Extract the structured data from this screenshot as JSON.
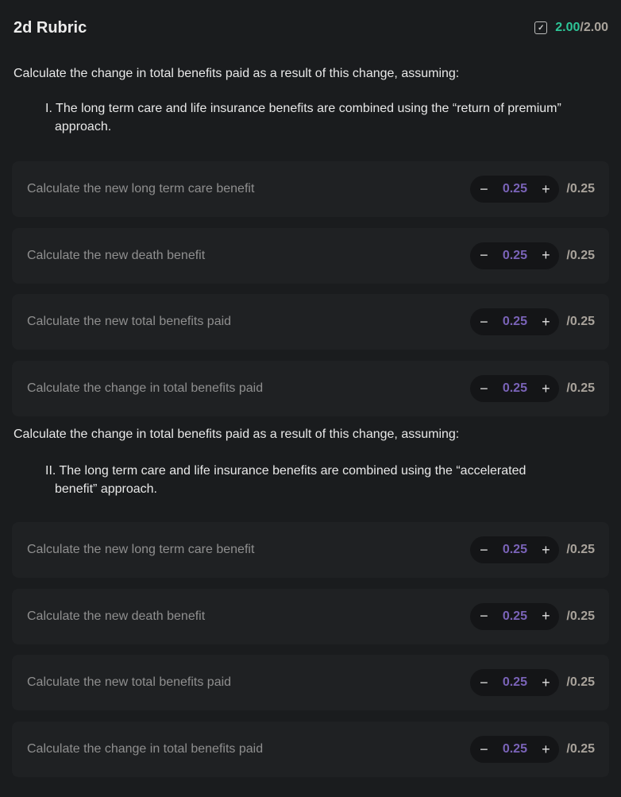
{
  "header": {
    "title": "2d Rubric",
    "score": "2.00",
    "total": "/2.00",
    "check_icon": "checkbox-checked-icon"
  },
  "colors": {
    "score": "#2dc597",
    "points": "#7a63b8",
    "background": "#1a1c1e"
  },
  "sections": [
    {
      "prompt": "Calculate the change in total benefits paid as a result of this change, assuming:",
      "item": "I. The long term care and life insurance benefits are combined using the “return of premium” approach.",
      "criteria": [
        {
          "label": "Calculate the new long term care benefit",
          "value": "0.25",
          "max": "/0.25"
        },
        {
          "label": "Calculate the new death benefit",
          "value": "0.25",
          "max": "/0.25"
        },
        {
          "label": "Calculate the new total benefits paid",
          "value": "0.25",
          "max": "/0.25"
        },
        {
          "label": "Calculate the change in total benefits paid",
          "value": "0.25",
          "max": "/0.25"
        }
      ]
    },
    {
      "prompt": "Calculate the change in total benefits paid as a result of this change, assuming:",
      "item": "II. The long term care and life insurance benefits are combined using the “accelerated benefit” approach.",
      "criteria": [
        {
          "label": "Calculate the new long term care benefit",
          "value": "0.25",
          "max": "/0.25"
        },
        {
          "label": "Calculate the new death benefit",
          "value": "0.25",
          "max": "/0.25"
        },
        {
          "label": "Calculate the new total benefits paid",
          "value": "0.25",
          "max": "/0.25"
        },
        {
          "label": "Calculate the change in total benefits paid",
          "value": "0.25",
          "max": "/0.25"
        }
      ]
    }
  ],
  "controls": {
    "minus": "−",
    "plus": "+"
  }
}
